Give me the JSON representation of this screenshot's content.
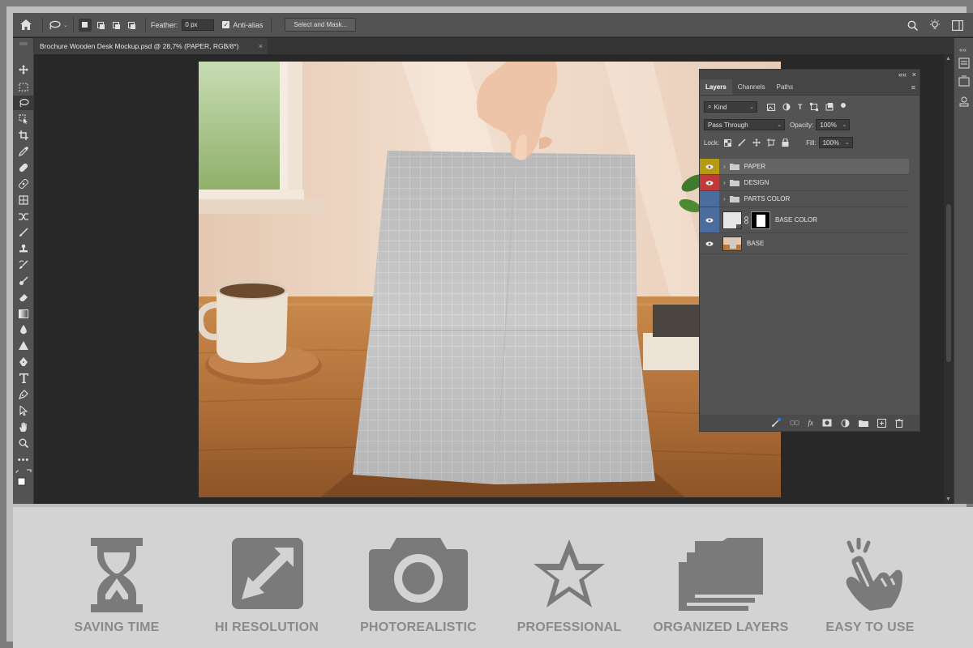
{
  "optionsBar": {
    "feather_label": "Feather:",
    "feather_value": "0 px",
    "antialias_label": "Anti-alias",
    "select_mask_label": "Select and Mask..."
  },
  "document": {
    "tab_title": "Brochure Wooden Desk Mockup.psd @ 28,7% (PAPER, RGB/8*)",
    "close": "×"
  },
  "layersPanel": {
    "tabs": [
      "Layers",
      "Channels",
      "Paths"
    ],
    "filter_kind": "Kind",
    "blend_mode": "Pass Through",
    "opacity_label": "Opacity:",
    "opacity_value": "100%",
    "lock_label": "Lock:",
    "fill_label": "Fill:",
    "fill_value": "100%",
    "layers": [
      {
        "name": "PAPER",
        "type": "group",
        "eye_color": "#b59a14",
        "visible": true,
        "selected": true
      },
      {
        "name": "DESIGN",
        "type": "group",
        "eye_color": "#c03a3a",
        "visible": true,
        "selected": false
      },
      {
        "name": "PARTS COLOR",
        "type": "group",
        "eye_color": "#4a6d9e",
        "visible": false,
        "selected": false
      },
      {
        "name": "BASE COLOR",
        "type": "smart-object-with-mask",
        "eye_color": "#4a6d9e",
        "visible": true,
        "selected": false
      },
      {
        "name": "BASE",
        "type": "image",
        "eye_color": "",
        "visible": true,
        "selected": false
      }
    ]
  },
  "features": [
    {
      "label": "SAVING TIME",
      "icon": "hourglass-icon"
    },
    {
      "label": "HI RESOLUTION",
      "icon": "expand-arrows-icon"
    },
    {
      "label": "PHOTOREALISTIC",
      "icon": "camera-icon"
    },
    {
      "label": "PROFESSIONAL",
      "icon": "star-icon"
    },
    {
      "label": "ORGANIZED LAYERS",
      "icon": "stacked-folders-icon"
    },
    {
      "label": "EASY TO USE",
      "icon": "tap-hand-icon"
    }
  ],
  "colors": {
    "ps_panel": "#535353",
    "ps_bg": "#282828",
    "feature_icon": "#7a7a7a",
    "feature_label": "#8a8a8a"
  }
}
